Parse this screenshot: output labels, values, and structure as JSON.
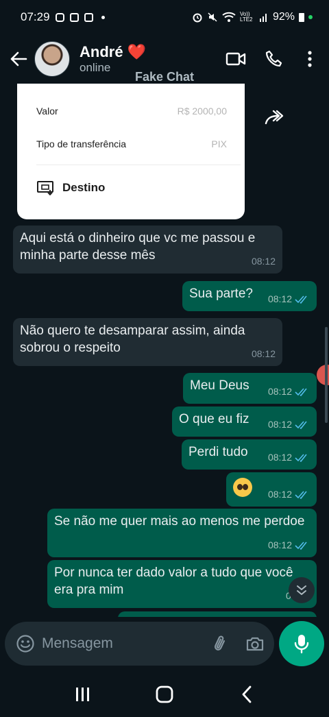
{
  "status_bar": {
    "time": "07:29",
    "battery": "92%",
    "network": "Vo)) LTE2"
  },
  "header": {
    "contact_name": "André ❤️",
    "contact_status": "online",
    "watermark": "Fake Chat"
  },
  "transfer_card": {
    "rows": [
      {
        "label": "Valor",
        "value": "R$ 2000,00"
      },
      {
        "label": "Tipo de transferência",
        "value": "PIX"
      }
    ],
    "destination_label": "Destino"
  },
  "messages": [
    {
      "direction": "in",
      "text": "Aqui está o dinheiro que vc me passou e minha parte desse mês",
      "time": "08:12"
    },
    {
      "direction": "out",
      "text": "Sua parte?",
      "time": "08:12"
    },
    {
      "direction": "in",
      "text": "Não quero te desamparar assim, ainda sobrou o respeito",
      "time": "08:12"
    },
    {
      "direction": "out",
      "text": "Meu Deus",
      "time": "08:12"
    },
    {
      "direction": "out",
      "text": "O que eu fiz",
      "time": "08:12"
    },
    {
      "direction": "out",
      "text": "Perdi tudo",
      "time": "08:12"
    },
    {
      "direction": "out",
      "text": "",
      "emoji": "pleading-face",
      "time": "08:12"
    },
    {
      "direction": "out",
      "text": "Se não me quer mais ao menos me perdoe",
      "time": "08:12"
    },
    {
      "direction": "out",
      "text": "Por nunca ter dado valor a tudo que você era pra mim",
      "time": "08:12"
    }
  ],
  "composer": {
    "placeholder": "Mensagem"
  },
  "colors": {
    "background": "#0b141a",
    "incoming": "#202c33",
    "outgoing": "#005c4b",
    "accent": "#00a884",
    "read_ticks": "#53bdeb"
  }
}
